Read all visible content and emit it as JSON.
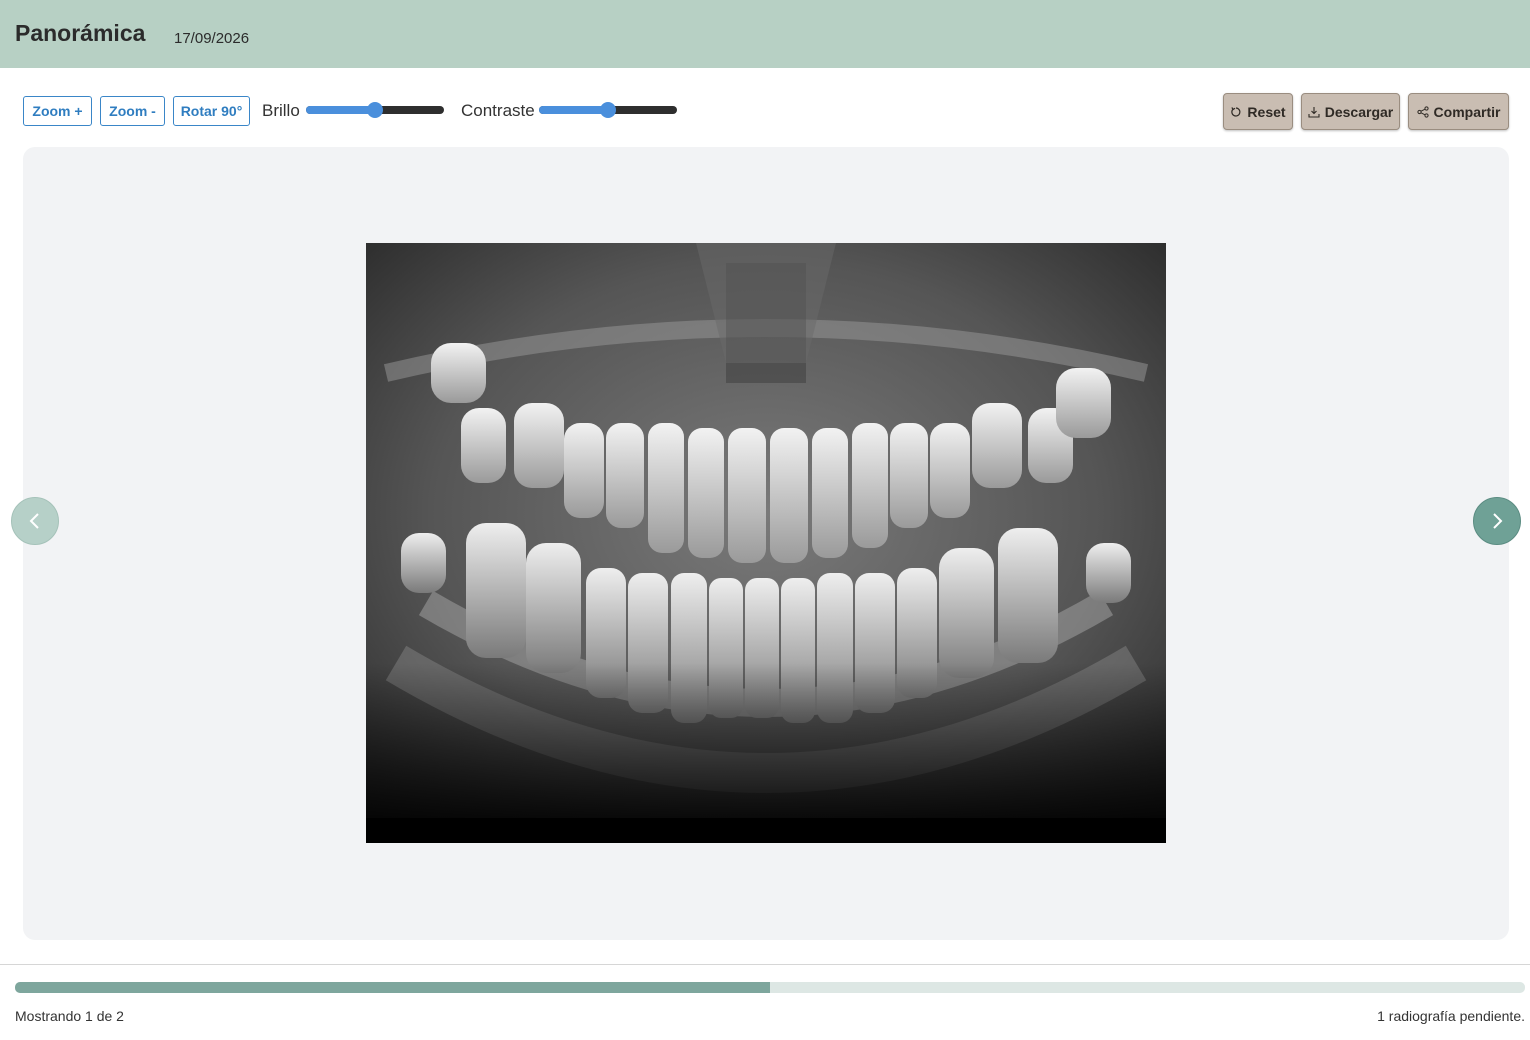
{
  "header": {
    "title": "Panorámica",
    "date": "17/09/2026",
    "background_color": "#b7d0c4"
  },
  "toolbar": {
    "zoom_in_label": "Zoom +",
    "zoom_out_label": "Zoom -",
    "rotate_label": "Rotar 90°",
    "brightness": {
      "label": "Brillo",
      "value_fraction": 0.5
    },
    "contrast": {
      "label": "Contraste",
      "value_fraction": 0.5
    },
    "accent_color": "#4a8fdc"
  },
  "actions": {
    "reset_label": "Reset",
    "download_label": "Descargar",
    "share_label": "Compartir",
    "reset_icon": "rotate-ccw-icon",
    "download_icon": "download-icon",
    "share_icon": "share-icon"
  },
  "viewer": {
    "image_description_icon": "panoramic-xray-image",
    "prev_icon": "chevron-left-icon",
    "next_icon": "chevron-right-icon"
  },
  "footer": {
    "progress_fraction": 0.5,
    "progress_color": "#7ea69d",
    "status_left": "Mostrando 1 de 2",
    "status_right": "1 radiografía pendiente."
  }
}
